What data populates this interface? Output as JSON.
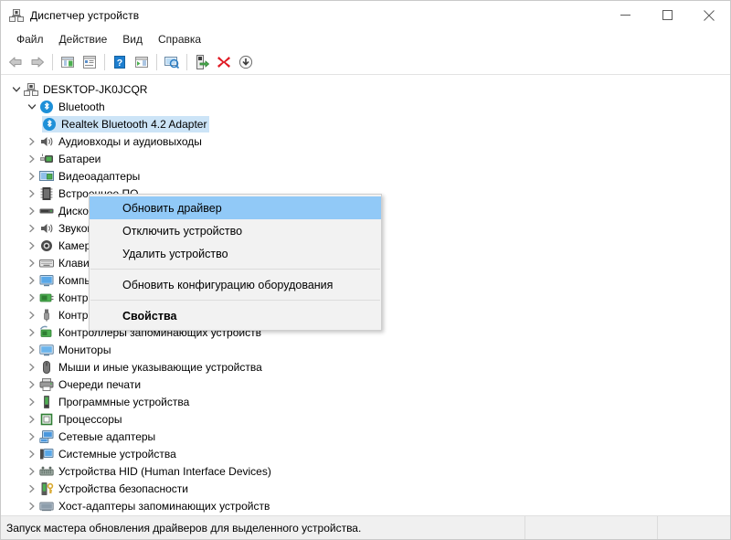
{
  "window": {
    "title": "Диспетчер устройств",
    "icon": "device-manager-icon",
    "controls": {
      "minimize": "minimize-icon",
      "maximize": "maximize-icon",
      "close": "close-icon"
    }
  },
  "menubar": {
    "items": [
      {
        "label": "Файл",
        "name": "menu-file"
      },
      {
        "label": "Действие",
        "name": "menu-action"
      },
      {
        "label": "Вид",
        "name": "menu-view"
      },
      {
        "label": "Справка",
        "name": "menu-help"
      }
    ]
  },
  "toolbar": {
    "buttons": [
      {
        "name": "back-icon",
        "title": "Назад",
        "enabled": false
      },
      {
        "name": "forward-icon",
        "title": "Вперёд",
        "enabled": false
      },
      {
        "name": "show-hide-console-tree-icon",
        "title": "Показать/скрыть дерево консоли",
        "enabled": true
      },
      {
        "name": "properties-icon",
        "title": "Свойства",
        "enabled": true
      },
      {
        "name": "help-icon",
        "title": "Справка",
        "enabled": true
      },
      {
        "name": "show-hide-action-pane-icon",
        "title": "Показать/скрыть панель действий",
        "enabled": true
      },
      {
        "name": "scan-hardware-changes-icon",
        "title": "Обновить конфигурацию оборудования",
        "enabled": true
      },
      {
        "name": "update-driver-icon",
        "title": "Обновить драйвер",
        "enabled": true
      },
      {
        "name": "uninstall-device-icon",
        "title": "Удалить устройство",
        "enabled": true
      },
      {
        "name": "disable-device-icon",
        "title": "Отключить устройство",
        "enabled": true
      }
    ]
  },
  "tree": {
    "root": {
      "label": "DESKTOP-JK0JCQR",
      "icon": "computer-root-icon",
      "expanded": true
    },
    "bluetooth": {
      "label": "Bluetooth",
      "icon": "bluetooth-icon",
      "expanded": true
    },
    "selected_device": {
      "label": "Realtek Bluetooth 4.2 Adapter",
      "icon": "bluetooth-icon",
      "selected": true
    },
    "categories": [
      {
        "label": "Аудиовходы и аудиовыходы",
        "icon": "audio-icon"
      },
      {
        "label": "Батареи",
        "icon": "battery-icon"
      },
      {
        "label": "Видеоадаптеры",
        "icon": "display-adapter-icon"
      },
      {
        "label": "Встроенное ПО",
        "icon": "firmware-icon"
      },
      {
        "label": "Дисковые устройства",
        "icon": "disk-drive-icon"
      },
      {
        "label": "Звуковые, игровые и видеоустройства",
        "icon": "sound-icon"
      },
      {
        "label": "Камеры",
        "icon": "camera-icon"
      },
      {
        "label": "Клавиатуры",
        "icon": "keyboard-icon"
      },
      {
        "label": "Компьютер",
        "icon": "computer-icon"
      },
      {
        "label": "Контроллеры IDE ATA/ATAPI",
        "icon": "ide-controller-icon"
      },
      {
        "label": "Контроллеры USB",
        "icon": "usb-icon"
      },
      {
        "label": "Контроллеры запоминающих устройств",
        "icon": "storage-controller-icon"
      },
      {
        "label": "Мониторы",
        "icon": "monitor-icon"
      },
      {
        "label": "Мыши и иные указывающие устройства",
        "icon": "mouse-icon"
      },
      {
        "label": "Очереди печати",
        "icon": "printer-icon"
      },
      {
        "label": "Программные устройства",
        "icon": "software-device-icon"
      },
      {
        "label": "Процессоры",
        "icon": "processor-icon"
      },
      {
        "label": "Сетевые адаптеры",
        "icon": "network-adapter-icon"
      },
      {
        "label": "Системные устройства",
        "icon": "system-device-icon"
      },
      {
        "label": "Устройства HID (Human Interface Devices)",
        "icon": "hid-icon"
      },
      {
        "label": "Устройства безопасности",
        "icon": "security-device-icon"
      },
      {
        "label": "Хост-адаптеры запоминающих устройств",
        "icon": "host-adapter-icon"
      }
    ]
  },
  "context_menu": {
    "items": [
      {
        "label": "Обновить драйвер",
        "name": "ctx-update-driver",
        "highlighted": true,
        "bold": false
      },
      {
        "label": "Отключить устройство",
        "name": "ctx-disable-device",
        "highlighted": false,
        "bold": false
      },
      {
        "label": "Удалить устройство",
        "name": "ctx-uninstall-device",
        "highlighted": false,
        "bold": false
      },
      {
        "separator": true
      },
      {
        "label": "Обновить конфигурацию оборудования",
        "name": "ctx-scan-hardware-changes",
        "highlighted": false,
        "bold": false
      },
      {
        "separator": true
      },
      {
        "label": "Свойства",
        "name": "ctx-properties",
        "highlighted": false,
        "bold": true
      }
    ]
  },
  "statusbar": {
    "message": "Запуск мастера обновления драйверов для выделенного устройства.",
    "pane2": "",
    "pane3": ""
  },
  "colors": {
    "selection_blue": "#cce4f7",
    "menu_highlight_blue": "#91c9f7",
    "statusbar_bg": "#f0f0f0",
    "menu_bg": "#f2f2f2",
    "bluetooth_blue": "#1e90d8",
    "close_red": "#e81123"
  }
}
